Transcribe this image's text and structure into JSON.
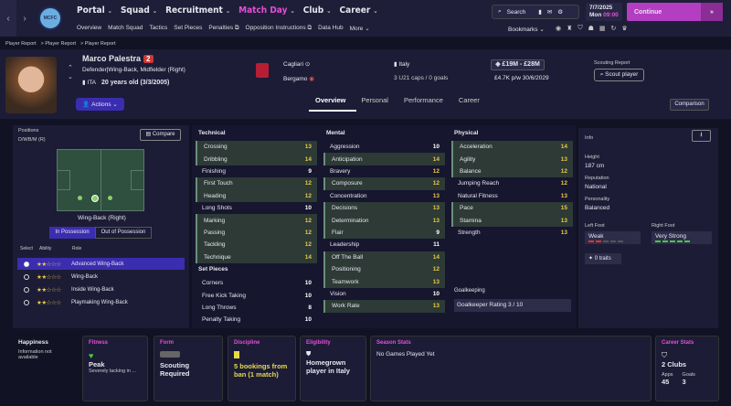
{
  "nav": {
    "items": [
      "Portal",
      "Squad",
      "Recruitment",
      "Match Day",
      "Club",
      "Career"
    ],
    "sub": [
      "Overview",
      "Match Squad",
      "Tactics",
      "Set Pieces",
      "Penalties ⧉",
      "Opposition Instructions ⧉",
      "Data Hub",
      "More ⌄"
    ],
    "search": "Search",
    "date_day": "7/7/2025",
    "date_dow": "Mon",
    "date_time": "09:00",
    "continue": "Continue",
    "bookmarks": "Bookmarks"
  },
  "breadcrumb": [
    "Player Report",
    "Player Report",
    "Player Report"
  ],
  "player": {
    "name": "Marco Palestra",
    "number": "2",
    "positions": "Defender|Wing-Back, Midfielder (Right)",
    "nat_code": "ITA",
    "age": "20 years old (3/3/2005)",
    "actions": "Actions"
  },
  "club": {
    "name": "Cagliari",
    "city": "Bergamo",
    "country": "Italy",
    "caps": "3 U21 caps / 0 goals",
    "value": "£19M - £28M",
    "wage": "£4.7K p/w 30/6/2029",
    "scout_label": "Scouting Report",
    "scout_btn": "Scout player"
  },
  "tabs": [
    "Overview",
    "Personal",
    "Performance",
    "Career"
  ],
  "comparison": "Comparison",
  "positions": {
    "title": "Positions",
    "sub": "D/WB/M (R)",
    "compare": "Compare",
    "role_name": "Wing-Back (Right)",
    "in": "In Possession",
    "out": "Out of Possession",
    "col_select": "Select",
    "col_ability": "Ability",
    "col_role": "Role",
    "roles": [
      {
        "name": "Advanced Wing-Back",
        "stars": "★★☆☆☆"
      },
      {
        "name": "Wing-Back",
        "stars": "★★☆☆☆"
      },
      {
        "name": "Inside Wing-Back",
        "stars": "★★☆☆☆"
      },
      {
        "name": "Playmaking Wing-Back",
        "stars": "★★☆☆☆"
      }
    ]
  },
  "technical": {
    "title": "Technical",
    "items": [
      [
        "Crossing",
        "13"
      ],
      [
        "Dribbling",
        "14"
      ],
      [
        "Finishing",
        "9"
      ],
      [
        "First Touch",
        "12"
      ],
      [
        "Heading",
        "12"
      ],
      [
        "Long Shots",
        "10"
      ],
      [
        "Marking",
        "12"
      ],
      [
        "Passing",
        "12"
      ],
      [
        "Tackling",
        "12"
      ],
      [
        "Technique",
        "14"
      ]
    ]
  },
  "setpieces": {
    "title": "Set Pieces",
    "items": [
      [
        "Corners",
        "10"
      ],
      [
        "Free Kick Taking",
        "10"
      ],
      [
        "Long Throws",
        "8"
      ],
      [
        "Penalty Taking",
        "10"
      ]
    ]
  },
  "mental": {
    "title": "Mental",
    "items": [
      [
        "Aggression",
        "10"
      ],
      [
        "Anticipation",
        "14"
      ],
      [
        "Bravery",
        "12"
      ],
      [
        "Composure",
        "12"
      ],
      [
        "Concentration",
        "13"
      ],
      [
        "Decisions",
        "13"
      ],
      [
        "Determination",
        "13"
      ],
      [
        "Flair",
        "9"
      ],
      [
        "Leadership",
        "11"
      ],
      [
        "Off The Ball",
        "14"
      ],
      [
        "Positioning",
        "12"
      ],
      [
        "Teamwork",
        "13"
      ],
      [
        "Vision",
        "10"
      ],
      [
        "Work Rate",
        "13"
      ]
    ]
  },
  "physical": {
    "title": "Physical",
    "items": [
      [
        "Acceleration",
        "14"
      ],
      [
        "Agility",
        "13"
      ],
      [
        "Balance",
        "12"
      ],
      [
        "Jumping Reach",
        "12"
      ],
      [
        "Natural Fitness",
        "13"
      ],
      [
        "Pace",
        "15"
      ],
      [
        "Stamina",
        "13"
      ],
      [
        "Strength",
        "13"
      ]
    ]
  },
  "goalkeeping": {
    "title": "Goalkeeping",
    "rating": "Goalkeeper Rating 3 / 10"
  },
  "info": {
    "title": "Info",
    "height_lbl": "Height",
    "height": "187 cm",
    "rep_lbl": "Reputation",
    "rep": "National",
    "pers_lbl": "Personality",
    "pers": "Balanced",
    "lf_lbl": "Left Foot",
    "lf": "Weak",
    "rf_lbl": "Right Foot",
    "rf": "Very Strong",
    "traits": "0 traits"
  },
  "cards": {
    "happiness": "Happiness",
    "happiness_note": "Information not available",
    "fitness": "Fitness",
    "fitness_val": "Peak",
    "fitness_note": "Severely lacking in ...",
    "form": "Form",
    "form_val": "Scouting Required",
    "discipline": "Discipline",
    "discipline_val": "5 bookings from ban (1 match)",
    "eligibility": "Eligibility",
    "elig_val": "Homegrown player in Italy",
    "season": "Season Stats",
    "season_val": "No Games Played Yet",
    "career": "Career Stats",
    "career_val": "2 Clubs",
    "apps_lbl": "Apps",
    "apps": "45",
    "goals_lbl": "Goals",
    "goals": "3"
  }
}
